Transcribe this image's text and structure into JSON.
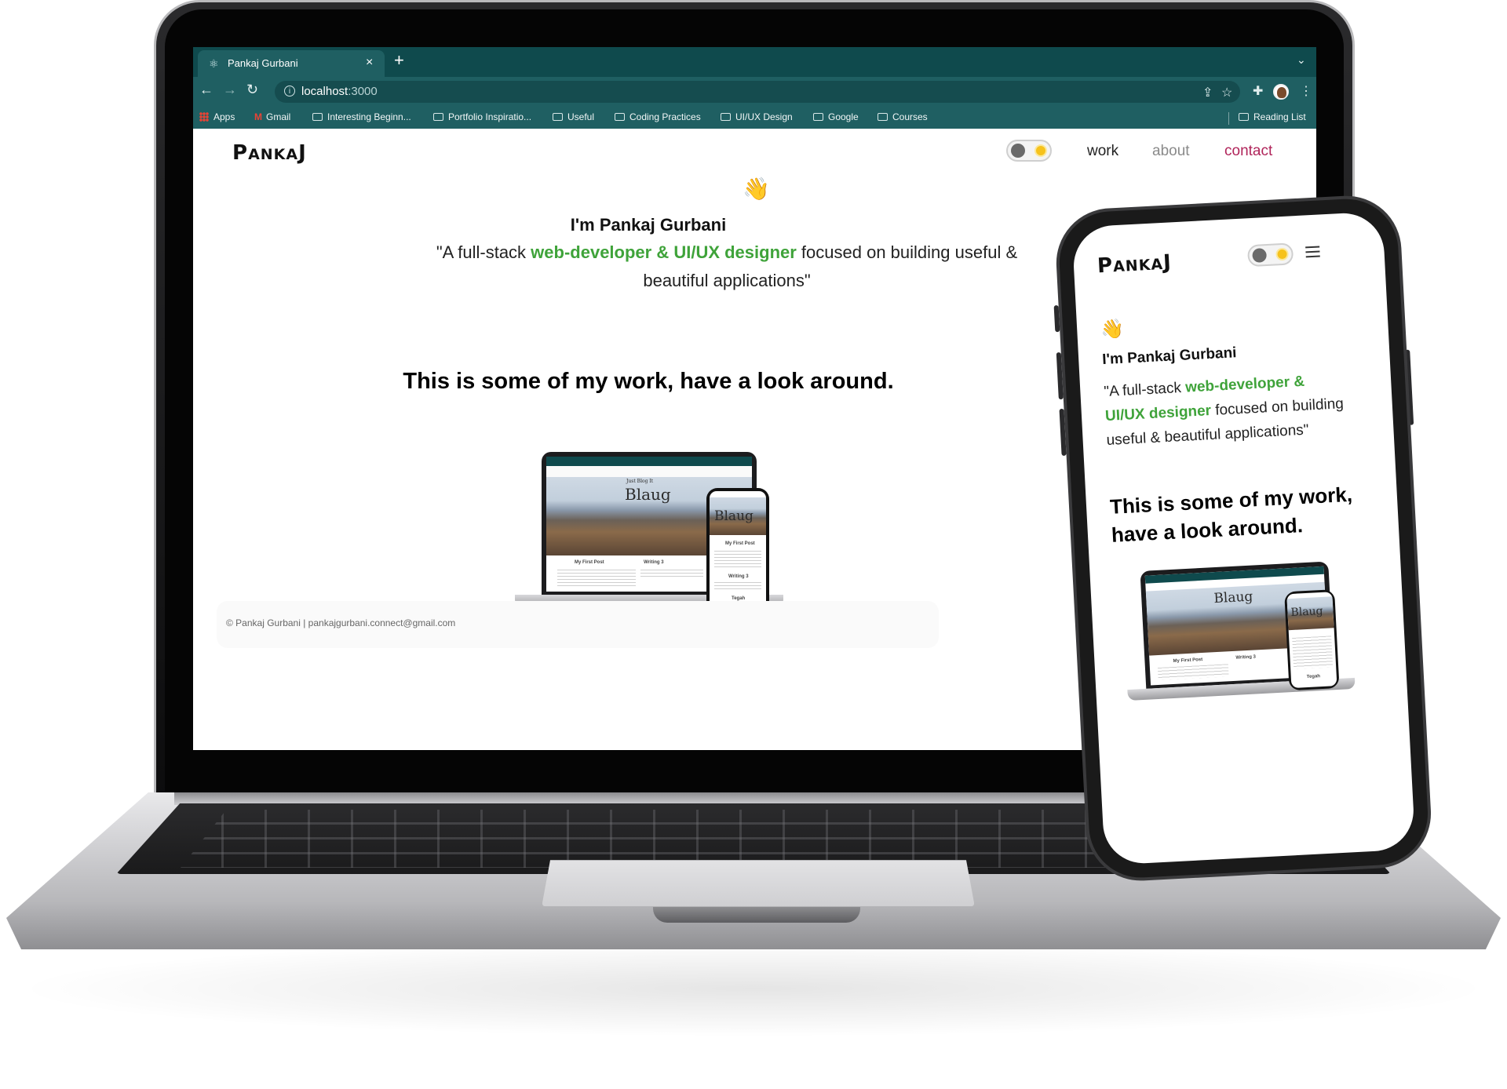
{
  "browser": {
    "tab_title": "Pankaj Gurbani",
    "tab_close": "×",
    "new_tab": "+",
    "url_host": "localhost",
    "url_port": ":3000",
    "bookmarks": [
      "Apps",
      "Gmail",
      "Interesting Beginn...",
      "Portfolio Inspiratio...",
      "Useful",
      "Coding Practices",
      "UI/UX Design",
      "Google",
      "Courses"
    ],
    "reading_list": "Reading List"
  },
  "site": {
    "logo_big": "P",
    "logo_small": "ANKA",
    "logo_end": "J",
    "nav": {
      "work": "work",
      "about": "about",
      "contact": "contact"
    },
    "wave": "👋",
    "hero_name": "I'm Pankaj Gurbani",
    "tag_open": "\"A full-stack ",
    "tag_highlight": "web-developer & UI/UX designer",
    "tag_rest": " focused on building useful & beautiful applications\"",
    "work_heading": "This is some of my work, have a look around.",
    "footer": "© Pankaj Gurbani | pankajgurbani.connect@gmail.com"
  },
  "mockup": {
    "title": "Blaug",
    "subtitle": "Just Blog It",
    "post1": "My First Post",
    "post2": "Writing 3",
    "post3": "Tegah"
  },
  "phone": {
    "tag_open": "\"A full-stack ",
    "tag_highlight_1": "web-developer &",
    "tag_highlight_2": "UI/UX designer",
    "tag_rest_1": " focused on building",
    "tag_rest_2": "useful & beautiful applications\"",
    "work_heading_1": "This is some of my work,",
    "work_heading_2": "have a look around."
  },
  "colors": {
    "browser_chrome": "#1f5f62",
    "accent_green": "#3fa33a",
    "contact_link": "#b0245a"
  }
}
